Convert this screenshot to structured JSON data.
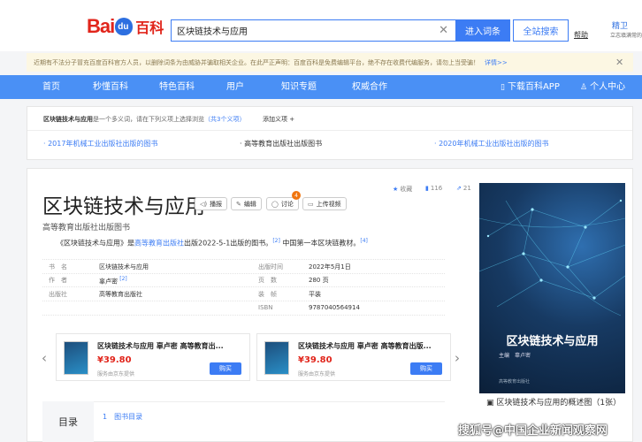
{
  "header": {
    "logo_text_1": "Bai",
    "logo_text_2": "百科",
    "search_value": "区块链技术与应用",
    "enter_button": "进入词条",
    "search_all_button": "全站搜索",
    "help": "帮助",
    "user_name": "精卫",
    "user_sub": "立志填满常的"
  },
  "notice": {
    "text": "近期有不法分子冒充百度百科官方人员，以删除词条为由威胁并骗取相关企业。在此严正声明：百度百科是免费编辑平台，绝不存在收费代编服务，请勿上当受骗！",
    "details": "详情>>"
  },
  "nav": {
    "items": [
      "首页",
      "秒懂百科",
      "特色百科",
      "用户",
      "知识专题",
      "权威合作"
    ],
    "download": "下载百科APP",
    "personal": "个人中心"
  },
  "polysemy": {
    "head_term": "区块链技术与应用",
    "head_text": "是一个多义词，请在下列义项上选择浏览",
    "head_count": "（共3个义项）",
    "add": "添加义项 +",
    "senses": [
      "2017年机械工业出版社出版的图书",
      "高等教育出版社出版图书",
      "2020年机械工业出版社出版的图书"
    ]
  },
  "entry": {
    "title": "区块链技术与应用",
    "tools": [
      "播报",
      "编辑",
      "讨论",
      "上传视频"
    ],
    "discuss_badge": "4",
    "collect": "收藏",
    "likes": "116",
    "shares": "21",
    "subtitle": "高等教育出版社出版图书",
    "summary_prefix": "《区块链技术与应用》是",
    "summary_link": "高等教育出版社",
    "summary_mid": "出版2022-5-1出版的图书。",
    "summary_ref1": "[2]",
    "summary_end": "中国第一本区块链教材。",
    "summary_ref2": "[4]"
  },
  "info": {
    "left": [
      {
        "key": "书　名",
        "value": "区块链技术与应用",
        "ref": ""
      },
      {
        "key": "作　者",
        "value": "辜卢密",
        "ref": "[2]"
      },
      {
        "key": "出版社",
        "value": "高等教育出版社",
        "ref": ""
      }
    ],
    "right": [
      {
        "key": "出版时间",
        "value": "2022年5月1日"
      },
      {
        "key": "页　数",
        "value": "280 页"
      },
      {
        "key": "装　帧",
        "value": "平装"
      },
      {
        "key": "ISBN",
        "value": "9787040564914"
      }
    ]
  },
  "products": [
    {
      "name": "区块链技术与应用 辜卢密 高等教育出...",
      "price": "¥39.80",
      "note": "服务由京东提供",
      "buy": "购买"
    },
    {
      "name": "区块链技术与应用 辜卢密 高等教育出版...",
      "price": "¥39.80",
      "note": "服务由京东提供",
      "buy": "购买"
    }
  ],
  "toc": {
    "label": "目录",
    "item": "1　图书目录"
  },
  "cover": {
    "title": "区块链技术与应用",
    "author": "主编　辜卢密",
    "publisher": "高等教育出版社",
    "caption": "区块链技术与应用的概述图（1张）"
  },
  "watermark": "搜狐号@中国企业新闻观察网",
  "colors": {
    "accent": "#3c7cf4",
    "nav": "#4a90f5",
    "brand_red": "#e1251b",
    "badge": "#f0750f"
  }
}
